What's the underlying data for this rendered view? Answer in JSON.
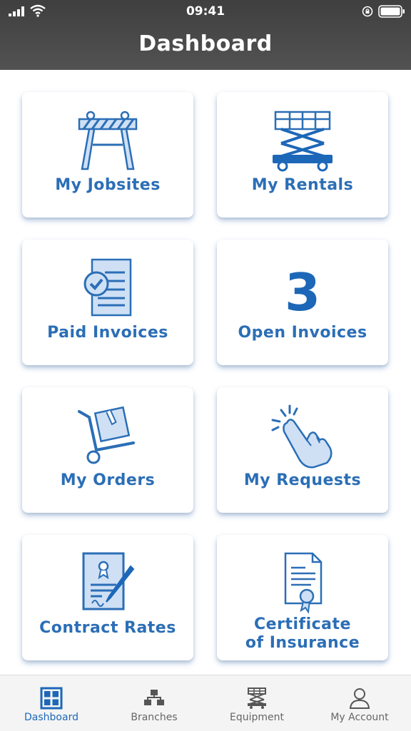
{
  "status_bar": {
    "time": "09:41"
  },
  "header": {
    "title": "Dashboard"
  },
  "tiles": [
    {
      "label": "My Jobsites",
      "icon": "barricade-icon"
    },
    {
      "label": "My Rentals",
      "icon": "scissor-lift-icon"
    },
    {
      "label": "Paid Invoices",
      "icon": "paid-invoice-icon"
    },
    {
      "label": "Open Invoices",
      "count": "3"
    },
    {
      "label": "My Orders",
      "icon": "hand-truck-icon"
    },
    {
      "label": "My Requests",
      "icon": "hand-tap-icon"
    },
    {
      "label": "Contract Rates",
      "icon": "contract-icon"
    },
    {
      "label_line1": "Certificate",
      "label_line2": "of Insurance",
      "icon": "certificate-icon"
    }
  ],
  "tab_bar": [
    {
      "label": "Dashboard",
      "icon": "dashboard-grid-icon",
      "active": true
    },
    {
      "label": "Branches",
      "icon": "branches-icon",
      "active": false
    },
    {
      "label": "Equipment",
      "icon": "equipment-icon",
      "active": false
    },
    {
      "label": "My Account",
      "icon": "person-icon",
      "active": false
    }
  ],
  "colors": {
    "accent": "#2b6eb6",
    "header": "#4a4a4a",
    "tabbar": "#f4f4f4"
  }
}
